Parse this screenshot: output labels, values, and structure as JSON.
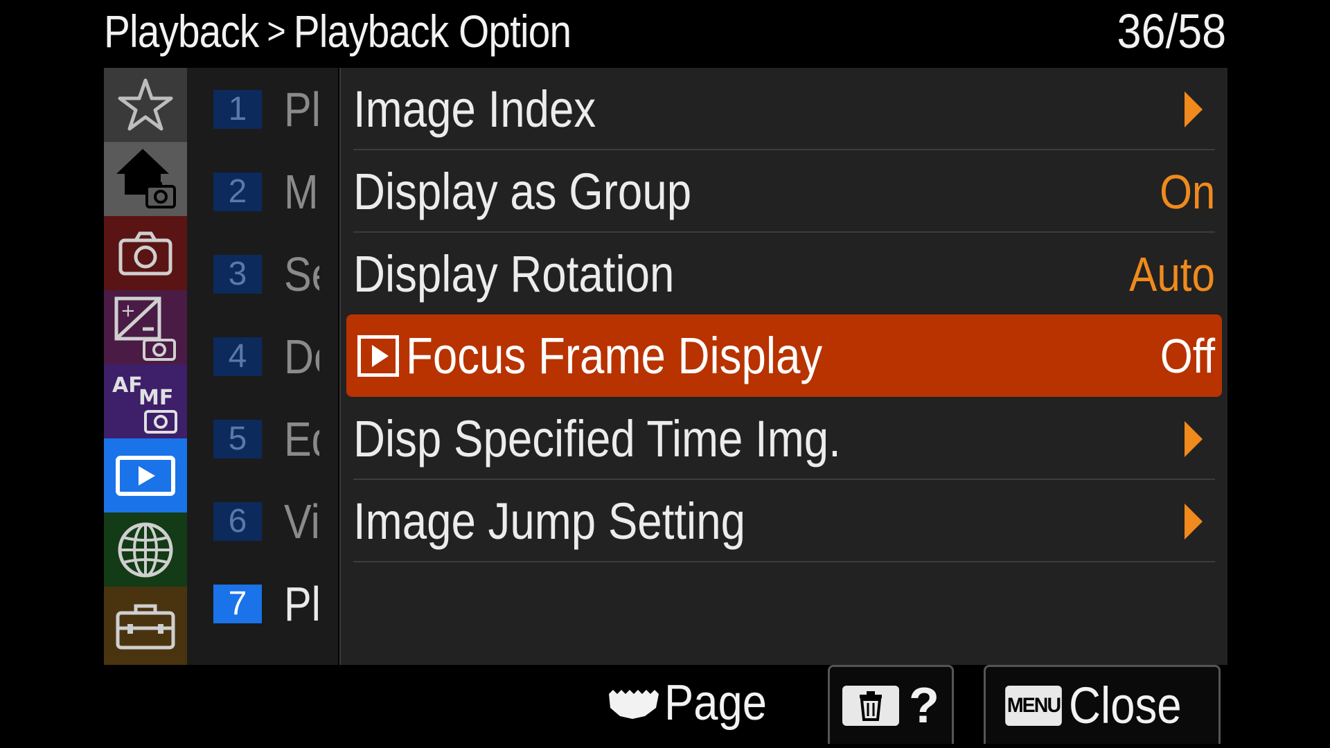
{
  "header": {
    "breadcrumb_section": "Playback",
    "breadcrumb_separator": ">",
    "breadcrumb_page": "Playback Option",
    "page_counter": "36/58"
  },
  "categories": [
    {
      "name": "my-menu",
      "icon": "star-icon",
      "color": "#3a3a3a"
    },
    {
      "name": "main-shooting",
      "icon": "home-camera-icon",
      "color": "#5a5a5a"
    },
    {
      "name": "shooting",
      "icon": "camera-icon",
      "color": "#5a1414"
    },
    {
      "name": "exposure-color",
      "icon": "exposure-camera-icon",
      "color": "#4a1b44"
    },
    {
      "name": "focus",
      "icon": "af-mf-camera-icon",
      "color": "#3d1f6a"
    },
    {
      "name": "playback",
      "icon": "play-icon",
      "color": "#1a73e8",
      "selected": true
    },
    {
      "name": "network",
      "icon": "globe-icon",
      "color": "#133b16"
    },
    {
      "name": "setup",
      "icon": "toolbox-icon",
      "color": "#4a3410"
    }
  ],
  "pages": [
    {
      "num": "1",
      "label": "Pl"
    },
    {
      "num": "2",
      "label": "M"
    },
    {
      "num": "3",
      "label": "Se"
    },
    {
      "num": "4",
      "label": "De"
    },
    {
      "num": "5",
      "label": "Ed"
    },
    {
      "num": "6",
      "label": "Vi"
    },
    {
      "num": "7",
      "label": "Pl",
      "active": true
    }
  ],
  "items": [
    {
      "label": "Image Index",
      "value": "",
      "type": "submenu"
    },
    {
      "label": "Display as Group",
      "value": "On",
      "type": "value"
    },
    {
      "label": "Display Rotation",
      "value": "Auto",
      "type": "value"
    },
    {
      "label": "Focus Frame Display",
      "value": "Off",
      "type": "value",
      "selected": true,
      "icon": "playback-icon"
    },
    {
      "label": "Disp Specified Time Img.",
      "value": "",
      "type": "submenu"
    },
    {
      "label": "Image Jump Setting",
      "value": "",
      "type": "submenu"
    }
  ],
  "footer": {
    "page_label": "Page",
    "help_label": "?",
    "menu_key": "MENU",
    "close_label": "Close"
  },
  "colors": {
    "accent": "#f08a1d",
    "selected": "#b83300",
    "active_tab": "#1a73e8"
  }
}
